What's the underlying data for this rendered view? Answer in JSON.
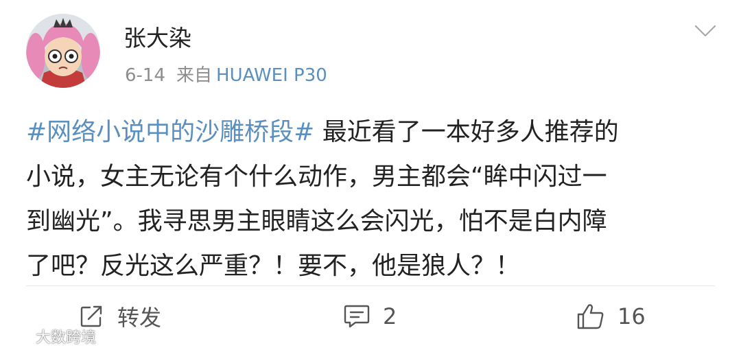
{
  "post": {
    "username": "张大染",
    "date": "6-14",
    "source_prefix": "来自",
    "device": "HUAWEI P30",
    "topic": "#网络小说中的沙雕桥段#",
    "lines": [
      " 最近看了一本好多人推荐的",
      "小说，女主无论有个什么动作，男主都会“眸中闪过一",
      "到幽光”。我寻思男主眼睛这么会闪光，怕不是白内障",
      "了吧？反光这么严重？！要不，他是狼人？！"
    ]
  },
  "actions": {
    "repost_label": "转发",
    "comment_count": "2",
    "like_count": "16"
  },
  "icons": {
    "avatar": "anime-avatar-icon",
    "menu": "chevron-down-icon",
    "repost": "repost-icon",
    "comment": "comment-icon",
    "like": "thumbs-up-icon",
    "watermark": "weibo-logo-icon"
  },
  "watermark": {
    "text": "大数跨境"
  },
  "colors": {
    "link": "#5b8fbf",
    "text": "#222222",
    "meta": "#8d8d8d",
    "icon": "#555555",
    "avatar_bg": "#dfe3e8",
    "avatar_hair": "#e88ab8"
  }
}
